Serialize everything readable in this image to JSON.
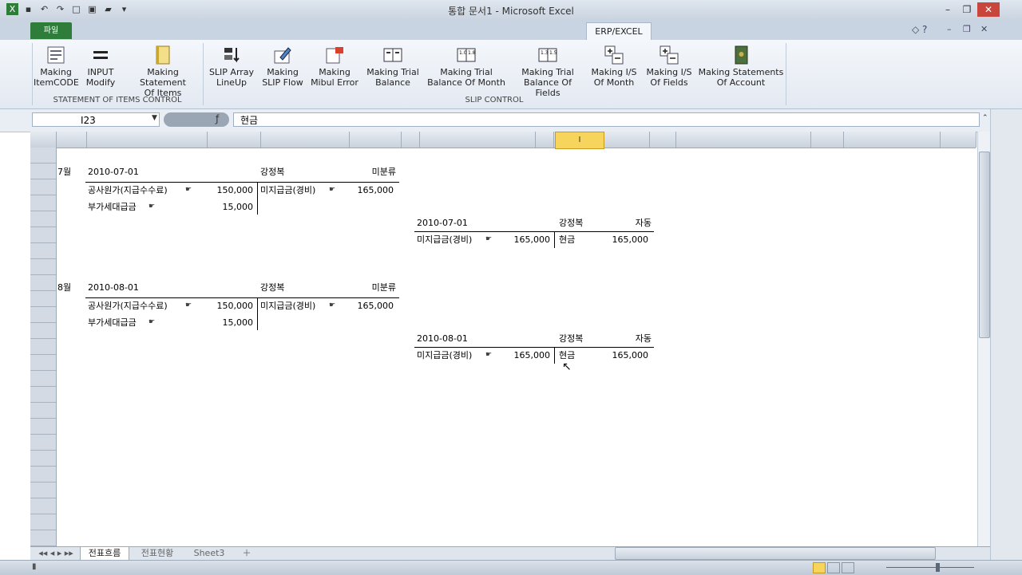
{
  "window": {
    "title": "통합 문서1 - Microsoft Excel"
  },
  "ribbon": {
    "file_tab": "파일",
    "active_tab": "ERP/EXCEL",
    "groups": [
      {
        "label": "STATEMENT OF ITEMS CONTROL"
      },
      {
        "label": "SLIP CONTROL"
      }
    ],
    "buttons": [
      {
        "label": "Making\nItemCODE",
        "icon": "form-icon"
      },
      {
        "label": "INPUT\nModify",
        "icon": "equals-icon"
      },
      {
        "label": "Making Statement\nOf Items",
        "icon": "book-icon"
      },
      {
        "label": "SLIP Array\nLineUp",
        "icon": "sort-icon"
      },
      {
        "label": "Making\nSLIP Flow",
        "icon": "pencil-icon"
      },
      {
        "label": "Making\nMibul Error",
        "icon": "error-icon"
      },
      {
        "label": "Making Trial\nBalance",
        "icon": "balance-icon"
      },
      {
        "label": "Making Trial\nBalance Of Month",
        "icon": "month-balance-icon"
      },
      {
        "label": "Making Trial\nBalance Of Fields",
        "icon": "field-balance-icon"
      },
      {
        "label": "Making I/S\nOf Month",
        "icon": "plus-minus-icon"
      },
      {
        "label": "Making I/S\nOf Fields",
        "icon": "plus-minus-icon"
      },
      {
        "label": "Making Statements\nOf Account",
        "icon": "ledger-icon"
      }
    ]
  },
  "formula_bar": {
    "name_box": "I23",
    "formula": "현금"
  },
  "columns": {
    "selected": "I"
  },
  "sheet": {
    "entries": [
      {
        "month": "7월",
        "journal": {
          "date": "2010-07-01",
          "person": "강정복",
          "status": "미분류",
          "debit": [
            {
              "account": "공사원가(지급수수료)",
              "amount": "150,000"
            },
            {
              "account": "부가세대급금",
              "amount": "15,000"
            }
          ],
          "credit": [
            {
              "account": "미지급금(경비)",
              "amount": "165,000"
            }
          ]
        },
        "payment": {
          "date": "2010-07-01",
          "person": "강정복",
          "status": "자동",
          "debit": {
            "account": "미지급금(경비)",
            "amount": "165,000"
          },
          "credit": {
            "account": "현금",
            "amount": "165,000"
          }
        }
      },
      {
        "month": "8월",
        "journal": {
          "date": "2010-08-01",
          "person": "강정복",
          "status": "미분류",
          "debit": [
            {
              "account": "공사원가(지급수수료)",
              "amount": "150,000"
            },
            {
              "account": "부가세대급금",
              "amount": "15,000"
            }
          ],
          "credit": [
            {
              "account": "미지급금(경비)",
              "amount": "165,000"
            }
          ]
        },
        "payment": {
          "date": "2010-08-01",
          "person": "강정복",
          "status": "자동",
          "debit": {
            "account": "미지급금(경비)",
            "amount": "165,000"
          },
          "credit": {
            "account": "현금",
            "amount": "165,000"
          }
        }
      }
    ]
  },
  "sheet_tabs": [
    {
      "label": "전표흐름",
      "active": true
    },
    {
      "label": "전표현황"
    },
    {
      "label": "Sheet3"
    }
  ]
}
